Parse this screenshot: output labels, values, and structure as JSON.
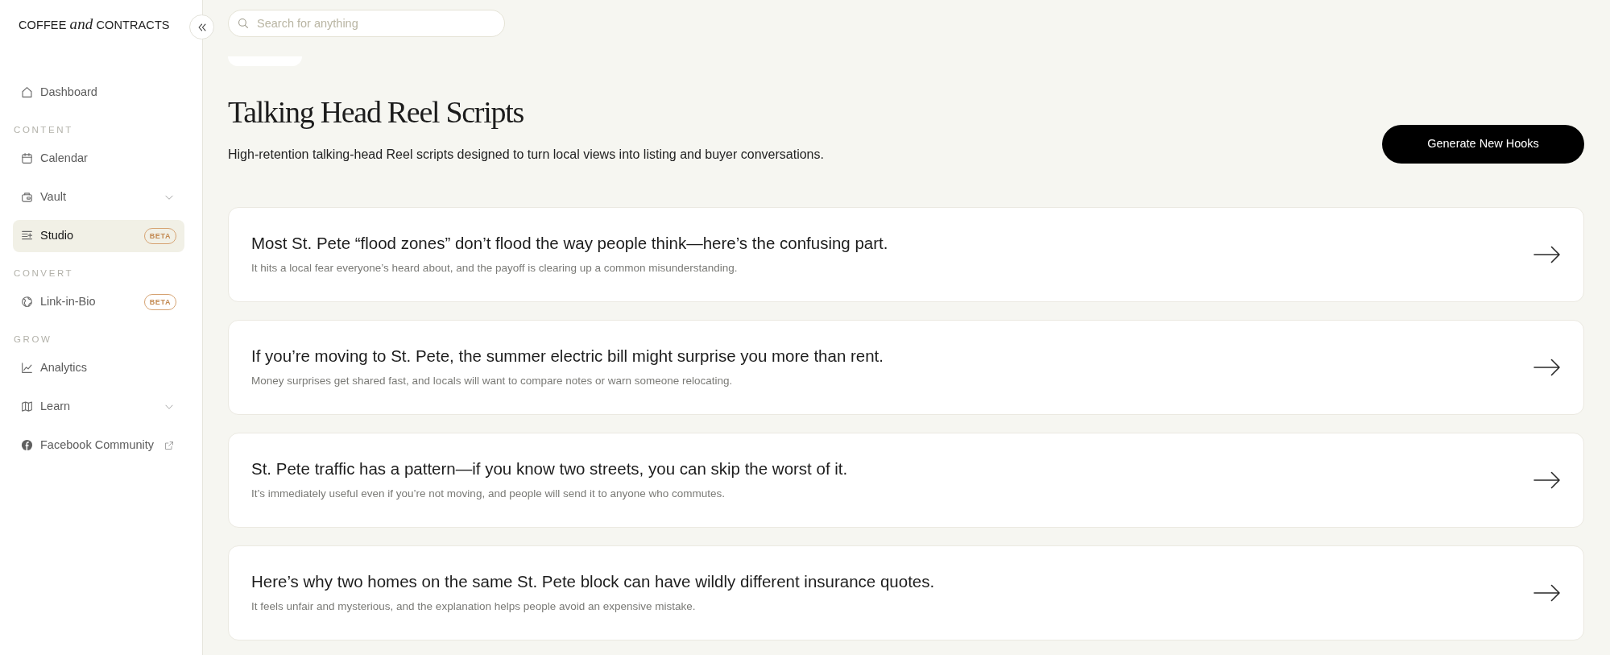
{
  "sidebar": {
    "logo": "COFFEE *and* CONTRACTS",
    "nav": [
      {
        "kind": "link",
        "label": "Dashboard",
        "selected": false
      },
      {
        "kind": "heading",
        "label": "CONTENT"
      },
      {
        "kind": "link",
        "label": "Calendar",
        "selected": false
      },
      {
        "kind": "group",
        "label": "Vault",
        "selected": false,
        "expanded": false
      },
      {
        "kind": "link",
        "label": "Studio",
        "selected": true,
        "badge": "BETA"
      },
      {
        "kind": "heading",
        "label": "CONVERT"
      },
      {
        "kind": "link",
        "label": "Link-in-Bio",
        "selected": false,
        "badge": "BETA"
      },
      {
        "kind": "heading",
        "label": "GROW"
      },
      {
        "kind": "link",
        "label": "Analytics",
        "selected": false
      },
      {
        "kind": "group",
        "label": "Learn",
        "selected": false,
        "expanded": false
      },
      {
        "kind": "external",
        "label": "Facebook Community",
        "selected": false
      }
    ]
  },
  "search": {
    "placeholder": "Search for anything"
  },
  "page": {
    "title": "Talking Head Reel Scripts",
    "subtitle": "High-retention talking-head Reel scripts designed to turn local views into listing and buyer conversations.",
    "action_button": "Generate New Hooks"
  },
  "hooks": [
    {
      "title": "Most St. Pete “flood zones” don’t flood the way people think—here’s the confusing part.",
      "description": "It hits a local fear everyone’s heard about, and the payoff is clearing up a common misunderstanding."
    },
    {
      "title": "If you’re moving to St. Pete, the summer electric bill might surprise you more than rent.",
      "description": "Money surprises get shared fast, and locals will want to compare notes or warn someone relocating."
    },
    {
      "title": "St. Pete traffic has a pattern—if you know two streets, you can skip the worst of it.",
      "description": "It’s immediately useful even if you’re not moving, and people will send it to anyone who commutes."
    },
    {
      "title": "Here’s why two homes on the same St. Pete block can have wildly different insurance quotes.",
      "description": "It feels unfair and mysterious, and the explanation helps people avoid an expensive mistake."
    }
  ]
}
